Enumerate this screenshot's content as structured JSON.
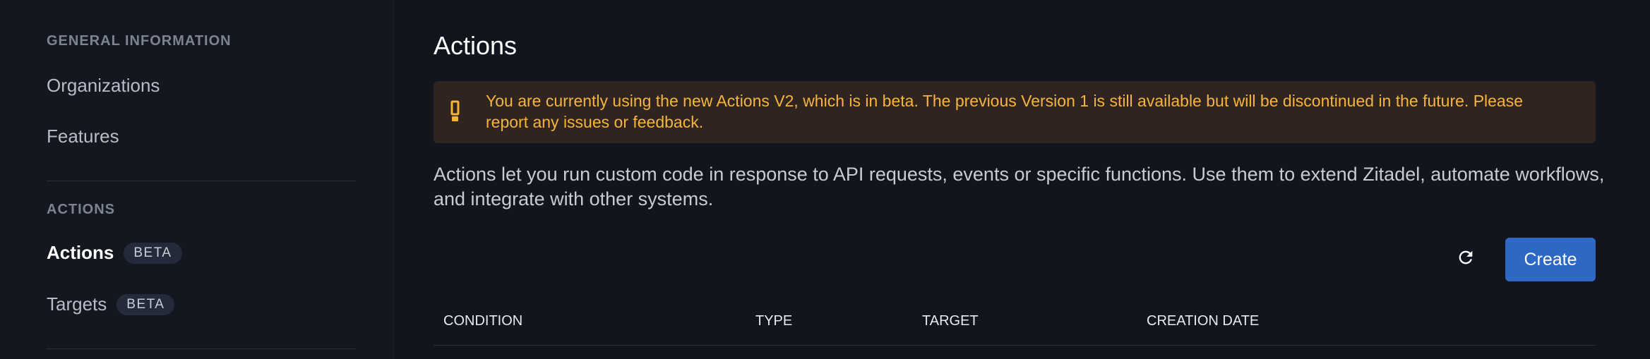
{
  "sidebar": {
    "sections": [
      {
        "title": "GENERAL INFORMATION",
        "items": [
          {
            "label": "Organizations"
          },
          {
            "label": "Features"
          }
        ]
      },
      {
        "title": "ACTIONS",
        "items": [
          {
            "label": "Actions",
            "badge": "BETA",
            "active": true
          },
          {
            "label": "Targets",
            "badge": "BETA"
          }
        ]
      }
    ]
  },
  "main": {
    "title": "Actions",
    "warning": {
      "icon": "exclamation-icon",
      "text": "You are currently using the new Actions V2, which is in beta. The previous Version 1 is still available but will be discontinued in the future. Please report any issues or feedback."
    },
    "description": "Actions let you run custom code in response to API requests, events or specific functions. Use them to extend Zitadel, automate workflows, and integrate with other systems.",
    "toolbar": {
      "refresh_icon": "refresh-icon",
      "create_label": "Create"
    },
    "table": {
      "columns": [
        "CONDITION",
        "TYPE",
        "TARGET",
        "CREATION DATE"
      ]
    }
  },
  "colors": {
    "background": "#12151e",
    "sidebar": "#141720",
    "warning_bg": "#302421",
    "warning_text": "#f5b53d",
    "primary": "#2d68c2"
  }
}
